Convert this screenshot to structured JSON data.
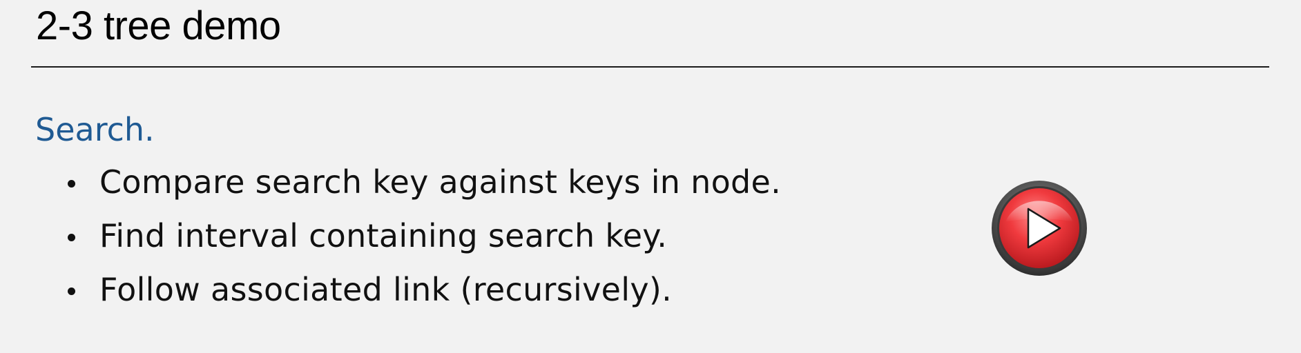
{
  "slide": {
    "title": "2-3 tree demo"
  },
  "section": {
    "heading": "Search.",
    "heading_color": "#1f5a93"
  },
  "bullets": [
    "Compare search key against keys in node.",
    "Find interval containing search key.",
    "Follow associated link (recursively)."
  ],
  "play_button": {
    "icon": "play-icon",
    "color": "#e8282c"
  }
}
